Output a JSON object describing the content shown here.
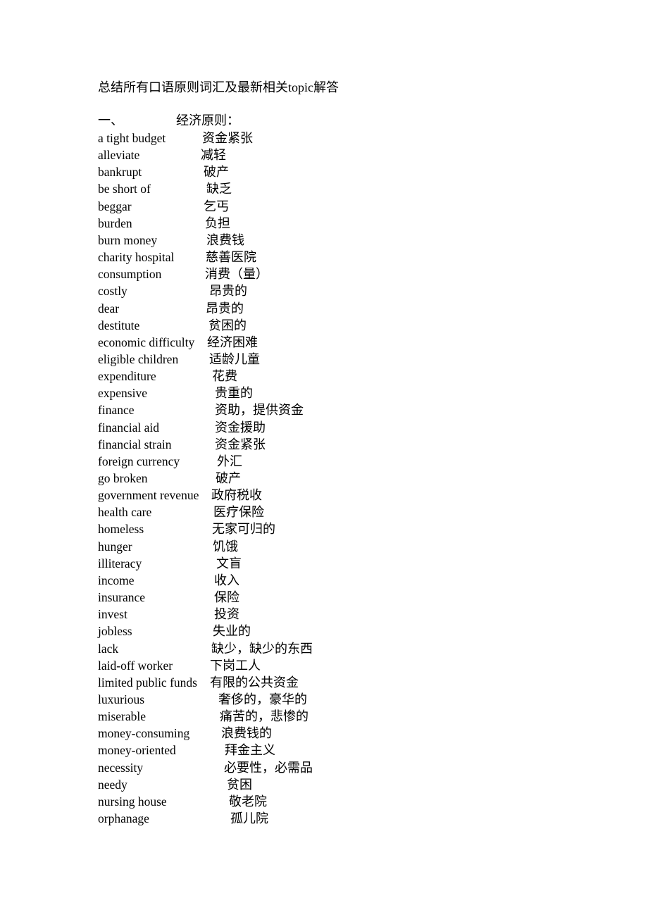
{
  "document": {
    "title": "总结所有口语原则词汇及最新相关topic解答",
    "section": {
      "number": "一、",
      "name": "经济原则："
    },
    "entries": [
      {
        "en": "a tight budget",
        "zh": "资金紧张"
      },
      {
        "en": "alleviate",
        "zh": "减轻"
      },
      {
        "en": "bankrupt",
        "zh": "破产"
      },
      {
        "en": "be short of",
        "zh": "缺乏"
      },
      {
        "en": "beggar",
        "zh": "乞丐"
      },
      {
        "en": "burden",
        "zh": "负担"
      },
      {
        "en": "burn money",
        "zh": "浪费钱"
      },
      {
        "en": "charity hospital",
        "zh": "慈善医院"
      },
      {
        "en": "consumption",
        "zh": "消费（量）"
      },
      {
        "en": "costly",
        "zh": "昂贵的"
      },
      {
        "en": "dear",
        "zh": "昂贵的"
      },
      {
        "en": "destitute",
        "zh": "贫困的"
      },
      {
        "en": "economic difficulty",
        "zh": "经济困难"
      },
      {
        "en": "eligible children",
        "zh": "适龄儿童"
      },
      {
        "en": "expenditure",
        "zh": "花费"
      },
      {
        "en": "expensive",
        "zh": "贵重的"
      },
      {
        "en": "finance",
        "zh": "资助，提供资金"
      },
      {
        "en": "financial aid",
        "zh": "资金援助"
      },
      {
        "en": "financial strain",
        "zh": "资金紧张"
      },
      {
        "en": "foreign currency",
        "zh": "外汇"
      },
      {
        "en": "go broken",
        "zh": "破产"
      },
      {
        "en": "government revenue",
        "zh": "政府税收"
      },
      {
        "en": "health care",
        "zh": "医疗保险"
      },
      {
        "en": "homeless",
        "zh": "无家可归的"
      },
      {
        "en": "hunger",
        "zh": "饥饿"
      },
      {
        "en": "illiteracy",
        "zh": "文盲"
      },
      {
        "en": "income",
        "zh": "收入"
      },
      {
        "en": "insurance",
        "zh": "保险"
      },
      {
        "en": "invest",
        "zh": "投资"
      },
      {
        "en": "jobless",
        "zh": "失业的"
      },
      {
        "en": "lack",
        "zh": "缺少，缺少的东西"
      },
      {
        "en": "laid-off worker",
        "zh": "下岗工人"
      },
      {
        "en": "limited public funds",
        "zh": "有限的公共资金"
      },
      {
        "en": "luxurious",
        "zh": "奢侈的，豪华的"
      },
      {
        "en": "miserable",
        "zh": "痛苦的，悲惨的"
      },
      {
        "en": "money-consuming",
        "zh": "浪费钱的"
      },
      {
        "en": "money-oriented",
        "zh": "拜金主义"
      },
      {
        "en": "necessity",
        "zh": "必要性，必需品"
      },
      {
        "en": "needy",
        "zh": "贫困"
      },
      {
        "en": "nursing house",
        "zh": "敬老院"
      },
      {
        "en": "orphanage",
        "zh": "孤儿院"
      }
    ]
  }
}
